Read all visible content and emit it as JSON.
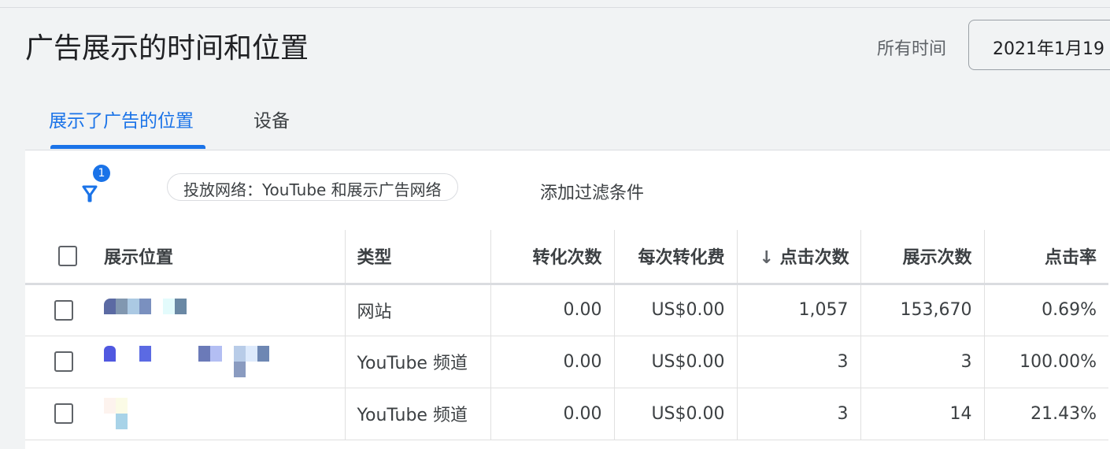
{
  "header": {
    "title": "广告展示的时间和位置",
    "time_label": "所有时间",
    "date_range": "2021年1月19"
  },
  "tabs": [
    {
      "label": "展示了广告的位置",
      "active": true
    },
    {
      "label": "设备",
      "active": false
    }
  ],
  "filter": {
    "count": "1",
    "chip": "投放网络：YouTube 和展示广告网络",
    "add_label": "添加过滤条件"
  },
  "table": {
    "columns": [
      "展示位置",
      "类型",
      "转化次数",
      "每次转化费",
      "点击次数",
      "展示次数",
      "点击率"
    ],
    "sort_arrow": "↓",
    "rows": [
      {
        "type": "网站",
        "conversions": "0.00",
        "cost_per_conv": "US$0.00",
        "clicks": "1,057",
        "impressions": "153,670",
        "ctr": "0.69%"
      },
      {
        "type": "YouTube 频道",
        "conversions": "0.00",
        "cost_per_conv": "US$0.00",
        "clicks": "3",
        "impressions": "3",
        "ctr": "100.00%"
      },
      {
        "type": "YouTube 频道",
        "conversions": "0.00",
        "cost_per_conv": "US$0.00",
        "clicks": "3",
        "impressions": "14",
        "ctr": "21.43%"
      }
    ]
  },
  "colors": {
    "accent": "#1a73e8",
    "background": "#f1f3f4"
  }
}
